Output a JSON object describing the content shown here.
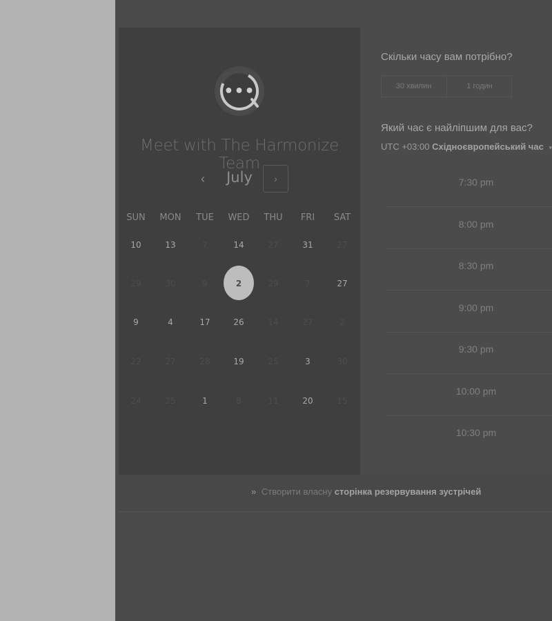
{
  "scheduler": {
    "title": "Meet with The Harmonize Team",
    "month": "July",
    "prev_icon": "‹",
    "next_icon": "›",
    "logo_glyph": "•••",
    "weekdays": [
      "SUN",
      "MON",
      "TUE",
      "WED",
      "THU",
      "FRI",
      "SAT"
    ],
    "weeks": [
      [
        {
          "d": "10",
          "a": true
        },
        {
          "d": "13",
          "a": true
        },
        {
          "d": "7",
          "a": false
        },
        {
          "d": "14",
          "a": true
        },
        {
          "d": "27",
          "a": false
        },
        {
          "d": "31",
          "a": true
        },
        {
          "d": "27",
          "a": false
        }
      ],
      [
        {
          "d": "29",
          "a": false
        },
        {
          "d": "30",
          "a": false
        },
        {
          "d": "9",
          "a": false
        },
        {
          "d": "2",
          "a": true,
          "s": true
        },
        {
          "d": "29",
          "a": false
        },
        {
          "d": "7",
          "a": false
        },
        {
          "d": "27",
          "a": true
        }
      ],
      [
        {
          "d": "9",
          "a": true
        },
        {
          "d": "4",
          "a": true
        },
        {
          "d": "17",
          "a": true
        },
        {
          "d": "26",
          "a": true
        },
        {
          "d": "14",
          "a": false
        },
        {
          "d": "27",
          "a": false
        },
        {
          "d": "2",
          "a": false
        }
      ],
      [
        {
          "d": "22",
          "a": false
        },
        {
          "d": "27",
          "a": false
        },
        {
          "d": "28",
          "a": false
        },
        {
          "d": "19",
          "a": true
        },
        {
          "d": "25",
          "a": false
        },
        {
          "d": "3",
          "a": true
        },
        {
          "d": "30",
          "a": false
        }
      ],
      [
        {
          "d": "24",
          "a": false
        },
        {
          "d": "25",
          "a": false
        },
        {
          "d": "1",
          "a": true
        },
        {
          "d": "8",
          "a": false
        },
        {
          "d": "11",
          "a": false
        },
        {
          "d": "20",
          "a": true
        },
        {
          "d": "15",
          "a": false
        }
      ]
    ]
  },
  "duration": {
    "question": "Скільки часу вам потрібно?",
    "options": [
      "30 хвилин",
      "1 годин"
    ]
  },
  "time": {
    "question": "Який час є найліпшим для вас?",
    "tz_offset": "UTC +03:00",
    "tz_name": "Східноєвропейський час",
    "tz_caret": "▾",
    "slots": [
      "7:30 pm",
      "8:00 pm",
      "8:30 pm",
      "9:00 pm",
      "9:30 pm",
      "10:00 pm",
      "10:30 pm"
    ]
  },
  "footer": {
    "icon": "»",
    "prefix": "Створити власну",
    "link": "сторінка резервування зустрічей"
  }
}
